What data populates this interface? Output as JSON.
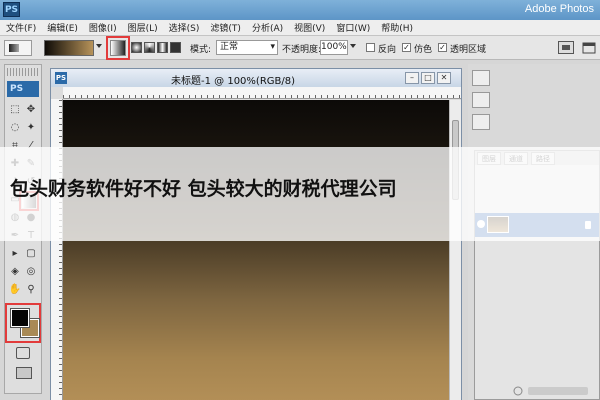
{
  "app": {
    "title": "Adobe Photos",
    "logo_text": "PS"
  },
  "menu": [
    "文件(F)",
    "编辑(E)",
    "图像(I)",
    "图层(L)",
    "选择(S)",
    "滤镜(T)",
    "分析(A)",
    "视图(V)",
    "窗口(W)",
    "帮助(H)"
  ],
  "options": {
    "mode_label": "模式:",
    "mode_value": "正常",
    "opacity_label": "不透明度:",
    "opacity_value": "100%",
    "reverse_label": "反向",
    "dither_label": "仿色",
    "transparency_label": "透明区域"
  },
  "document": {
    "title": "未标题-1 @ 100%(RGB/8)"
  },
  "panels": {
    "tabs": [
      "图层",
      "通道",
      "路径"
    ]
  },
  "overlay": {
    "text": "包头财务软件好不好 包头较大的财税代理公司"
  },
  "colors": {
    "foreground": "#050505",
    "background": "#a98a55",
    "highlight": "#e23b3b",
    "title_bar": "#5d95c7"
  }
}
